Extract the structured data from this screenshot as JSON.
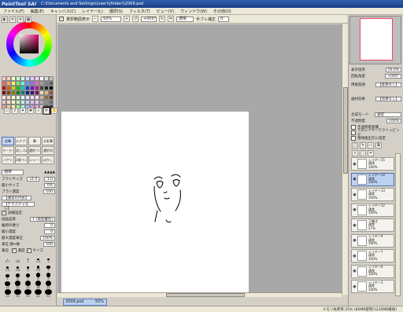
{
  "titlebar": {
    "app": "PaintTool SAI",
    "path": "C:\\Documents and Settings\\(user)\\(folder)\\2009.psd"
  },
  "menu": [
    "ファイル(F)",
    "編集(E)",
    "キャンバス(C)",
    "レイヤー(L)",
    "選択(S)",
    "フィルタ(T)",
    "ビュー(V)",
    "ウィンドウ(W)",
    "その他(O)"
  ],
  "toolbar": {
    "selection_check_label": "選択範囲表示",
    "zoom": "50%",
    "angle": "+000°",
    "mode": "通常",
    "stabilizer_label": "手ブレ補正",
    "stabilizer": "0"
  },
  "colors": {
    "palette": [
      "#ffcccc",
      "#ffd9b3",
      "#ffffcc",
      "#ccffcc",
      "#ccffff",
      "#cce0ff",
      "#e0ccff",
      "#ffccf0",
      "#ffffff",
      "#e0e0e0",
      "#c0c0c0",
      "#ff6666",
      "#ffad66",
      "#ffff66",
      "#66ff66",
      "#66ffff",
      "#6699ff",
      "#a366ff",
      "#ff66cc",
      "#a0a0a0",
      "#808080",
      "#606060",
      "#cc0000",
      "#cc6600",
      "#cccc00",
      "#00cc00",
      "#00cccc",
      "#0044cc",
      "#6600cc",
      "#cc0088",
      "#404040",
      "#202020",
      "#000000",
      "#800000",
      "#804000",
      "#808000",
      "#008000",
      "#008080",
      "#002080",
      "#400080",
      "#800050",
      "#f5deb3",
      "#deb887",
      "#a0522d",
      "#ffe4e1",
      "#ffdab9",
      "#fafad2",
      "#e0ffe0",
      "#e0ffff",
      "#e6e6fa",
      "#f0e0ff",
      "#ffe0f0",
      "#c8b89a",
      "#8b6b4a",
      "#5a3e2b",
      "#f8c8c8",
      "#f8e0c0",
      "#f8f8c0",
      "#c8f0c8",
      "#c0f0f0",
      "#c8d8f8",
      "#d8c8f8",
      "#f8c8e8",
      "#b0b0b0",
      "#909090",
      "#707070",
      "#ff9999",
      "#ffcc99",
      "#ffff99",
      "#99ff99",
      "#99ffff",
      "#99bbff",
      "#cc99ff",
      "#ff99dd",
      "#d0d0d0",
      "#505050",
      "#303030"
    ],
    "primary": "#000000",
    "secondary": "#ffffff"
  },
  "tools": [
    {
      "label": "鉛筆",
      "selected": true
    },
    {
      "label": "エアブラシ",
      "selected": false
    },
    {
      "label": "筆",
      "selected": false
    },
    {
      "label": "水彩筆",
      "selected": false
    },
    {
      "label": "マーカー",
      "selected": false
    },
    {
      "label": "消しゴム",
      "selected": false
    },
    {
      "label": "選択ペン",
      "selected": false
    },
    {
      "label": "選択消",
      "selected": false
    },
    {
      "label": "バケツ",
      "selected": false
    },
    {
      "label": "2値ペン",
      "selected": false
    },
    {
      "label": "シャープ",
      "selected": false
    },
    {
      "label": "ぼかし",
      "selected": false
    }
  ],
  "brush": {
    "mode": "通常",
    "size_label": "ブラシサイズ",
    "size_mult": "x1.0",
    "size": "1.0",
    "min_size_label": "最小サイズ",
    "min_size": "0%",
    "density_label": "ブラシ濃度",
    "density": "100",
    "shape": "【通常の円形】",
    "texture": "【テクスチャなし】",
    "detail_label": "詳細設定",
    "quality_label": "描画品質",
    "quality": "1 (速度優先)",
    "edge_label": "輪郭の硬さ",
    "edge": "0",
    "min_density_label": "最小濃度",
    "min_density": "0",
    "max_pressure_label": "最大濃度筆圧",
    "max_pressure": "100%",
    "hard_soft_label": "筆圧 硬⇔軟",
    "hard_soft": "100",
    "pressure_label": "筆圧:",
    "pressure_density": "濃度",
    "pressure_size": "サイズ"
  },
  "sizes": [
    "0.7",
    "0.8",
    "1",
    "1.5",
    "2",
    "2.3",
    "2.6",
    "3",
    "3.5",
    "4",
    "5",
    "6",
    "7",
    "8",
    "9",
    "10",
    "12",
    "14",
    "16",
    "20",
    "25",
    "30",
    "35",
    "40",
    "50"
  ],
  "file_tab": {
    "name": "2009.psd",
    "zoom": "50%"
  },
  "right": {
    "zoom_label": "表示倍率",
    "zoom": "50.0%",
    "rotation_label": "回転角度",
    "rotation": "+000°",
    "effect_label": "用紙質感",
    "effect": "【質感なし】",
    "effect2_label": "画材効果",
    "effect2": "【効果なし】",
    "blend_label": "合成モード",
    "blend": "通常",
    "opacity_label": "不透明度",
    "opacity": "100%",
    "protect_label": "不透明度保護",
    "clip_label": "下のレイヤーでクリッピング",
    "ref_label": "領域検出元に指定"
  },
  "layers": [
    {
      "name": "レイヤー15",
      "mode": "通常",
      "opacity": "100%",
      "selected": false
    },
    {
      "name": "レイヤー14",
      "mode": "通常",
      "opacity": "100%",
      "selected": true
    },
    {
      "name": "レイヤー13",
      "mode": "通常",
      "opacity": "100%",
      "selected": false
    },
    {
      "name": "レイヤー12",
      "mode": "通常",
      "opacity": "100%",
      "selected": false
    },
    {
      "name": "下書き",
      "mode": "通常",
      "opacity": "27%",
      "selected": false
    },
    {
      "name": "レイヤー9",
      "mode": "通常",
      "opacity": "100%",
      "selected": false
    },
    {
      "name": "レイヤー7",
      "mode": "通常",
      "opacity": "100%",
      "selected": false
    },
    {
      "name": "レイヤー6",
      "mode": "通常",
      "opacity": "100%",
      "selected": false
    },
    {
      "name": "レイヤー3",
      "mode": "通常",
      "opacity": "100%",
      "selected": false
    }
  ],
  "status": {
    "memory": "メモリ負荷率:35% (80MB使用/1230MB確保)"
  }
}
